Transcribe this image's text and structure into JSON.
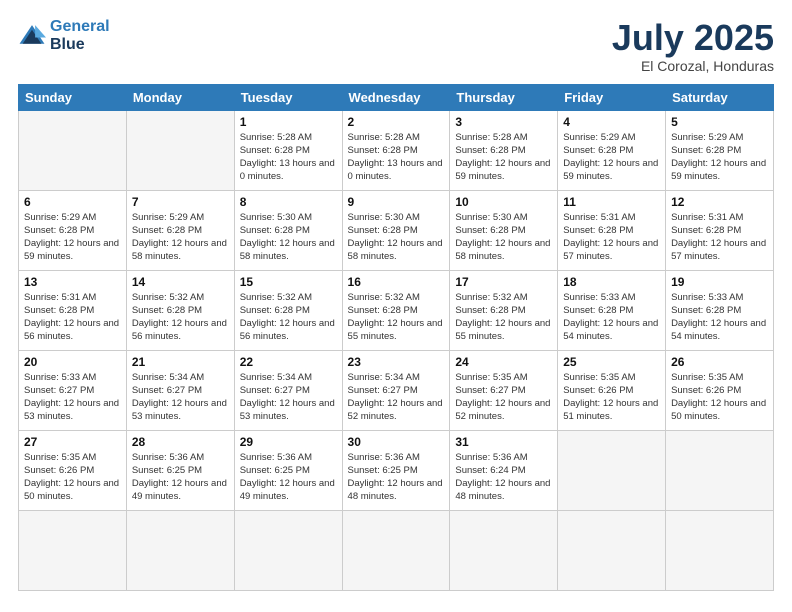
{
  "header": {
    "logo_line1": "General",
    "logo_line2": "Blue",
    "month_title": "July 2025",
    "location": "El Corozal, Honduras"
  },
  "weekdays": [
    "Sunday",
    "Monday",
    "Tuesday",
    "Wednesday",
    "Thursday",
    "Friday",
    "Saturday"
  ],
  "days": [
    {
      "num": "",
      "info": ""
    },
    {
      "num": "",
      "info": ""
    },
    {
      "num": "1",
      "info": "Sunrise: 5:28 AM\nSunset: 6:28 PM\nDaylight: 13 hours and 0 minutes."
    },
    {
      "num": "2",
      "info": "Sunrise: 5:28 AM\nSunset: 6:28 PM\nDaylight: 13 hours and 0 minutes."
    },
    {
      "num": "3",
      "info": "Sunrise: 5:28 AM\nSunset: 6:28 PM\nDaylight: 12 hours and 59 minutes."
    },
    {
      "num": "4",
      "info": "Sunrise: 5:29 AM\nSunset: 6:28 PM\nDaylight: 12 hours and 59 minutes."
    },
    {
      "num": "5",
      "info": "Sunrise: 5:29 AM\nSunset: 6:28 PM\nDaylight: 12 hours and 59 minutes."
    },
    {
      "num": "6",
      "info": "Sunrise: 5:29 AM\nSunset: 6:28 PM\nDaylight: 12 hours and 59 minutes."
    },
    {
      "num": "7",
      "info": "Sunrise: 5:29 AM\nSunset: 6:28 PM\nDaylight: 12 hours and 58 minutes."
    },
    {
      "num": "8",
      "info": "Sunrise: 5:30 AM\nSunset: 6:28 PM\nDaylight: 12 hours and 58 minutes."
    },
    {
      "num": "9",
      "info": "Sunrise: 5:30 AM\nSunset: 6:28 PM\nDaylight: 12 hours and 58 minutes."
    },
    {
      "num": "10",
      "info": "Sunrise: 5:30 AM\nSunset: 6:28 PM\nDaylight: 12 hours and 58 minutes."
    },
    {
      "num": "11",
      "info": "Sunrise: 5:31 AM\nSunset: 6:28 PM\nDaylight: 12 hours and 57 minutes."
    },
    {
      "num": "12",
      "info": "Sunrise: 5:31 AM\nSunset: 6:28 PM\nDaylight: 12 hours and 57 minutes."
    },
    {
      "num": "13",
      "info": "Sunrise: 5:31 AM\nSunset: 6:28 PM\nDaylight: 12 hours and 56 minutes."
    },
    {
      "num": "14",
      "info": "Sunrise: 5:32 AM\nSunset: 6:28 PM\nDaylight: 12 hours and 56 minutes."
    },
    {
      "num": "15",
      "info": "Sunrise: 5:32 AM\nSunset: 6:28 PM\nDaylight: 12 hours and 56 minutes."
    },
    {
      "num": "16",
      "info": "Sunrise: 5:32 AM\nSunset: 6:28 PM\nDaylight: 12 hours and 55 minutes."
    },
    {
      "num": "17",
      "info": "Sunrise: 5:32 AM\nSunset: 6:28 PM\nDaylight: 12 hours and 55 minutes."
    },
    {
      "num": "18",
      "info": "Sunrise: 5:33 AM\nSunset: 6:28 PM\nDaylight: 12 hours and 54 minutes."
    },
    {
      "num": "19",
      "info": "Sunrise: 5:33 AM\nSunset: 6:28 PM\nDaylight: 12 hours and 54 minutes."
    },
    {
      "num": "20",
      "info": "Sunrise: 5:33 AM\nSunset: 6:27 PM\nDaylight: 12 hours and 53 minutes."
    },
    {
      "num": "21",
      "info": "Sunrise: 5:34 AM\nSunset: 6:27 PM\nDaylight: 12 hours and 53 minutes."
    },
    {
      "num": "22",
      "info": "Sunrise: 5:34 AM\nSunset: 6:27 PM\nDaylight: 12 hours and 53 minutes."
    },
    {
      "num": "23",
      "info": "Sunrise: 5:34 AM\nSunset: 6:27 PM\nDaylight: 12 hours and 52 minutes."
    },
    {
      "num": "24",
      "info": "Sunrise: 5:35 AM\nSunset: 6:27 PM\nDaylight: 12 hours and 52 minutes."
    },
    {
      "num": "25",
      "info": "Sunrise: 5:35 AM\nSunset: 6:26 PM\nDaylight: 12 hours and 51 minutes."
    },
    {
      "num": "26",
      "info": "Sunrise: 5:35 AM\nSunset: 6:26 PM\nDaylight: 12 hours and 50 minutes."
    },
    {
      "num": "27",
      "info": "Sunrise: 5:35 AM\nSunset: 6:26 PM\nDaylight: 12 hours and 50 minutes."
    },
    {
      "num": "28",
      "info": "Sunrise: 5:36 AM\nSunset: 6:25 PM\nDaylight: 12 hours and 49 minutes."
    },
    {
      "num": "29",
      "info": "Sunrise: 5:36 AM\nSunset: 6:25 PM\nDaylight: 12 hours and 49 minutes."
    },
    {
      "num": "30",
      "info": "Sunrise: 5:36 AM\nSunset: 6:25 PM\nDaylight: 12 hours and 48 minutes."
    },
    {
      "num": "31",
      "info": "Sunrise: 5:36 AM\nSunset: 6:24 PM\nDaylight: 12 hours and 48 minutes."
    },
    {
      "num": "",
      "info": ""
    },
    {
      "num": "",
      "info": ""
    },
    {
      "num": "",
      "info": ""
    },
    {
      "num": "",
      "info": ""
    }
  ]
}
